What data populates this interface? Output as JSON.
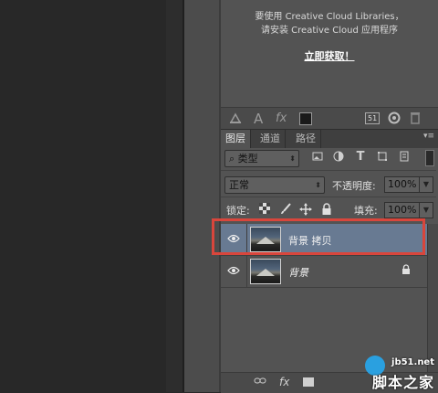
{
  "cc_message": {
    "line1": "要使用 Creative Cloud Libraries，",
    "line2": "请安装 Creative Cloud 应用程序",
    "link": "立即获取！"
  },
  "library_toolbar": {
    "icons": [
      "stamp-icon",
      "text-a-icon",
      "fx-icon",
      "color-swatch-icon",
      "library-count-icon",
      "cloud-sync-icon",
      "trash-icon"
    ],
    "text_a": "A",
    "fx": "fx",
    "count": "51"
  },
  "tabs": [
    {
      "label": "图层",
      "active": true
    },
    {
      "label": "通道",
      "active": false
    },
    {
      "label": "路径",
      "active": false
    }
  ],
  "filter": {
    "kind_label": "类型",
    "icons": [
      "image-filter-icon",
      "adjustment-filter-icon",
      "type-filter-icon",
      "shape-filter-icon",
      "smart-object-filter-icon"
    ],
    "type_glyph": "T"
  },
  "blend": {
    "mode": "正常",
    "opacity_label": "不透明度:",
    "opacity_value": "100%"
  },
  "lock": {
    "label": "锁定:",
    "icons": [
      "lock-transparent-icon",
      "lock-paint-icon",
      "lock-position-icon",
      "lock-all-icon"
    ],
    "fill_label": "填充:",
    "fill_value": "100%"
  },
  "layers": [
    {
      "name": "背景 拷贝",
      "selected": true,
      "visible": true,
      "locked": false
    },
    {
      "name": "背景",
      "selected": false,
      "visible": true,
      "locked": true
    }
  ],
  "bottom_bar": {
    "icons": [
      "link-layers-icon",
      "fx-icon",
      "mask-icon"
    ],
    "fx": "fx"
  },
  "watermark": {
    "url": "jb51.net",
    "name": "脚本之家"
  },
  "colors": {
    "highlight": "#d9463c",
    "selected_row": "#687a92",
    "panel_bg": "#535353"
  }
}
